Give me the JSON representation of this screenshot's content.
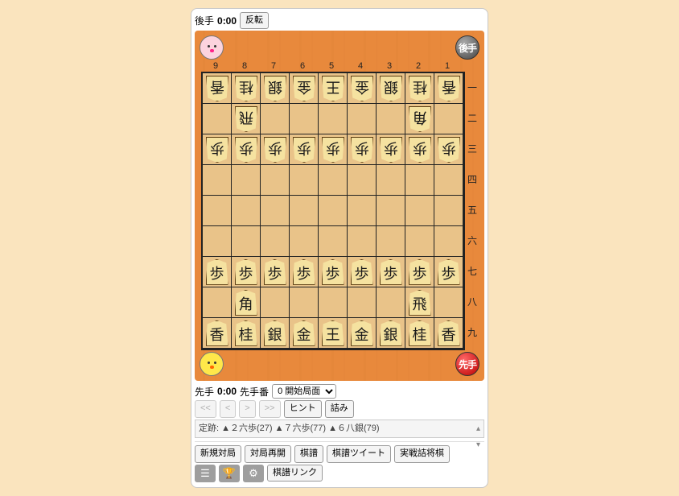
{
  "top": {
    "side_label": "後手",
    "clock": "0:00",
    "flip_button": "反転"
  },
  "hand_top": {
    "avatar": "pink-chick",
    "badge": "後手"
  },
  "hand_bottom": {
    "avatar": "yellow-chick",
    "badge": "先手"
  },
  "board": {
    "files": [
      "9",
      "8",
      "7",
      "6",
      "5",
      "4",
      "3",
      "2",
      "1"
    ],
    "ranks": [
      "一",
      "二",
      "三",
      "四",
      "五",
      "六",
      "七",
      "八",
      "九"
    ],
    "rows": [
      [
        {
          "k": "香",
          "s": "g"
        },
        {
          "k": "桂",
          "s": "g"
        },
        {
          "k": "銀",
          "s": "g"
        },
        {
          "k": "金",
          "s": "g"
        },
        {
          "k": "王",
          "s": "g"
        },
        {
          "k": "金",
          "s": "g"
        },
        {
          "k": "銀",
          "s": "g"
        },
        {
          "k": "桂",
          "s": "g"
        },
        {
          "k": "香",
          "s": "g"
        }
      ],
      [
        null,
        {
          "k": "飛",
          "s": "g"
        },
        null,
        null,
        null,
        null,
        null,
        {
          "k": "角",
          "s": "g"
        },
        null
      ],
      [
        {
          "k": "歩",
          "s": "g"
        },
        {
          "k": "歩",
          "s": "g"
        },
        {
          "k": "歩",
          "s": "g"
        },
        {
          "k": "歩",
          "s": "g"
        },
        {
          "k": "歩",
          "s": "g"
        },
        {
          "k": "歩",
          "s": "g"
        },
        {
          "k": "歩",
          "s": "g"
        },
        {
          "k": "歩",
          "s": "g"
        },
        {
          "k": "歩",
          "s": "g"
        }
      ],
      [
        null,
        null,
        null,
        null,
        null,
        null,
        null,
        null,
        null
      ],
      [
        null,
        null,
        null,
        null,
        null,
        null,
        null,
        null,
        null
      ],
      [
        null,
        null,
        null,
        null,
        null,
        null,
        null,
        null,
        null
      ],
      [
        {
          "k": "歩",
          "s": "s"
        },
        {
          "k": "歩",
          "s": "s"
        },
        {
          "k": "歩",
          "s": "s"
        },
        {
          "k": "歩",
          "s": "s"
        },
        {
          "k": "歩",
          "s": "s"
        },
        {
          "k": "歩",
          "s": "s"
        },
        {
          "k": "歩",
          "s": "s"
        },
        {
          "k": "歩",
          "s": "s"
        },
        {
          "k": "歩",
          "s": "s"
        }
      ],
      [
        null,
        {
          "k": "角",
          "s": "s"
        },
        null,
        null,
        null,
        null,
        null,
        {
          "k": "飛",
          "s": "s"
        },
        null
      ],
      [
        {
          "k": "香",
          "s": "s"
        },
        {
          "k": "桂",
          "s": "s"
        },
        {
          "k": "銀",
          "s": "s"
        },
        {
          "k": "金",
          "s": "s"
        },
        {
          "k": "王",
          "s": "s"
        },
        {
          "k": "金",
          "s": "s"
        },
        {
          "k": "銀",
          "s": "s"
        },
        {
          "k": "桂",
          "s": "s"
        },
        {
          "k": "香",
          "s": "s"
        }
      ]
    ]
  },
  "bottom": {
    "side_label": "先手",
    "clock": "0:00",
    "turn_label": "先手番",
    "move_select": "0 開始局面",
    "nav": {
      "first": "<<",
      "prev": "<",
      "next": ">",
      "last": ">>",
      "hint": "ヒント",
      "mate": "詰み"
    },
    "book": "定跡: ▲２六歩(27) ▲７六歩(77) ▲６八銀(79)"
  },
  "actions": {
    "new_game": "新規対局",
    "resume": "対局再開",
    "kifu": "棋譜",
    "tweet": "棋譜ツイート",
    "tsume": "実戦詰将棋",
    "link": "棋譜リンク"
  }
}
